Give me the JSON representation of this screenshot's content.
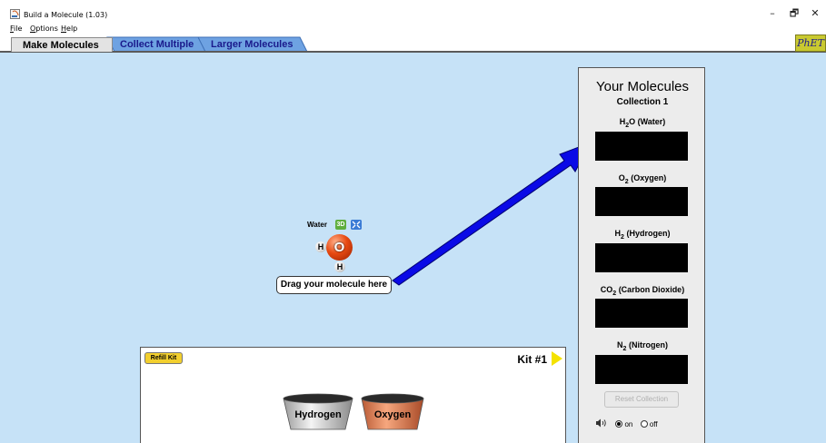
{
  "window": {
    "title": "Build a Molecule (1.03)",
    "controls": {
      "minimize": "–",
      "maximize": "🗗",
      "close": "✕"
    }
  },
  "menu": {
    "items": [
      {
        "accel": "F",
        "rest": "ile"
      },
      {
        "accel": "O",
        "rest": "ptions"
      },
      {
        "accel": "H",
        "rest": "elp"
      }
    ]
  },
  "tabs": [
    {
      "label": "Make Molecules",
      "active": true
    },
    {
      "label": "Collect Multiple",
      "active": false
    },
    {
      "label": "Larger Molecules",
      "active": false
    }
  ],
  "logo": {
    "text": "PhET"
  },
  "collection": {
    "title": "Your Molecules",
    "subtitle": "Collection 1",
    "molecules": [
      {
        "formula_main": "H",
        "formula_sub": "2",
        "formula_tail": "O (Water)"
      },
      {
        "formula_main": "O",
        "formula_sub": "2",
        "formula_tail": " (Oxygen)"
      },
      {
        "formula_main": "H",
        "formula_sub": "2",
        "formula_tail": " (Hydrogen)"
      },
      {
        "formula_main": "CO",
        "formula_sub": "2",
        "formula_tail": " (Carbon Dioxide)"
      },
      {
        "formula_main": "N",
        "formula_sub": "2",
        "formula_tail": " (Nitrogen)"
      }
    ],
    "reset_label": "Reset Collection",
    "sound": {
      "on_label": "on",
      "off_label": "off",
      "selected": "on"
    }
  },
  "molecule": {
    "name": "Water",
    "btn_3d": "3D",
    "center_atom": "O",
    "atoms": [
      "H",
      "H"
    ]
  },
  "drag_hint": "Drag your molecule here",
  "kit": {
    "refill_label": "Refill Kit",
    "title": "Kit #1",
    "buckets": [
      "Hydrogen",
      "Oxygen"
    ]
  },
  "colors": {
    "play_bg": "#c6e2f7",
    "arrow": "#0a0ae6",
    "oxygen": "#e84a12",
    "tab_text": "#1a1a8c"
  }
}
